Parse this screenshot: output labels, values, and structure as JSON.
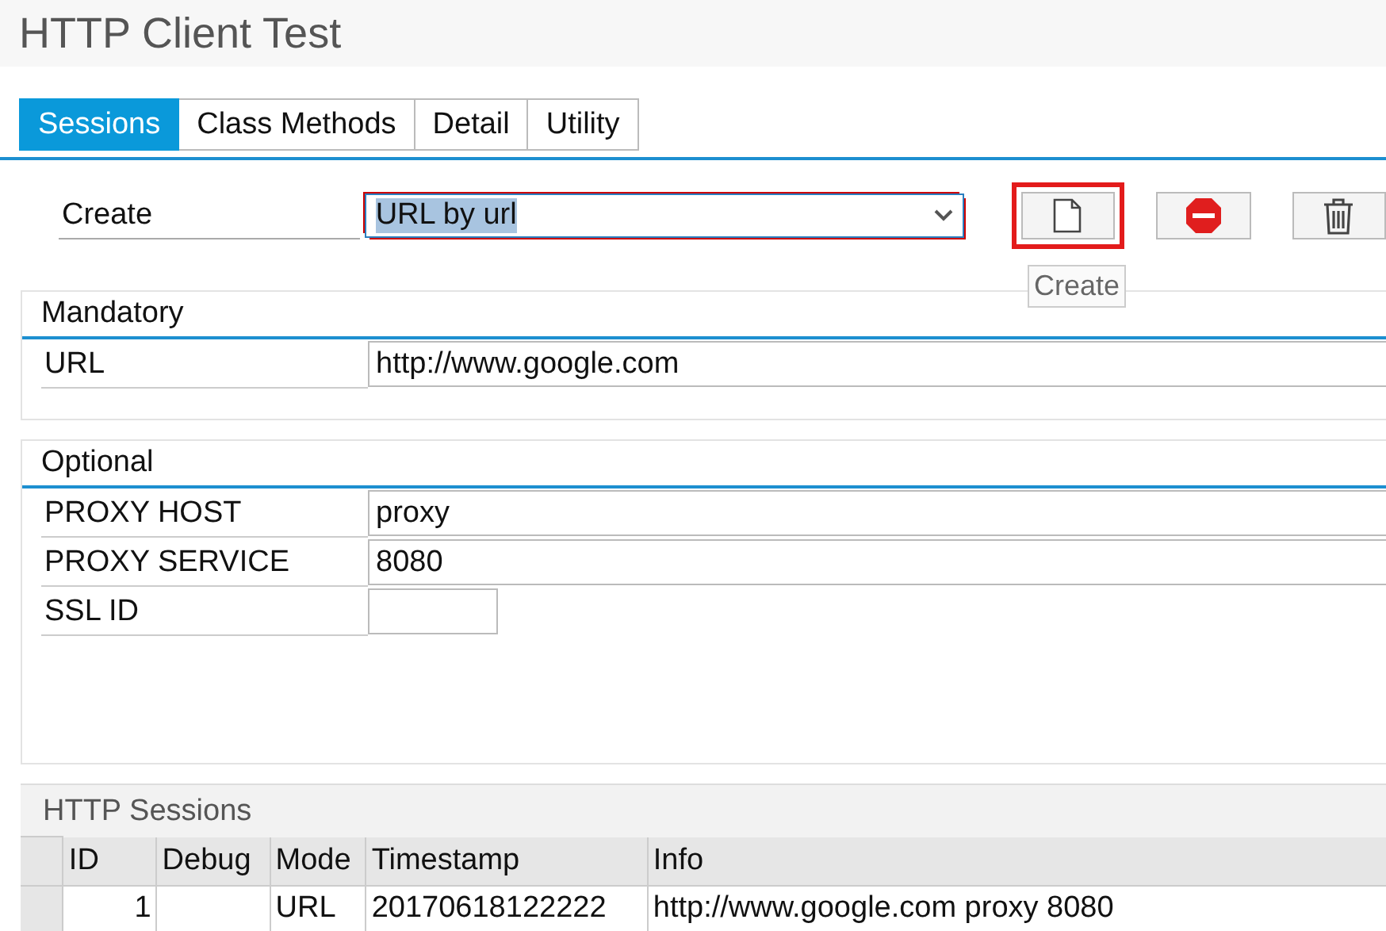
{
  "window": {
    "title": "HTTP Client Test"
  },
  "tabs": [
    {
      "label": "Sessions",
      "selected": true
    },
    {
      "label": "Class Methods",
      "selected": false
    },
    {
      "label": "Detail",
      "selected": false
    },
    {
      "label": "Utility",
      "selected": false
    }
  ],
  "create": {
    "label": "Create",
    "value": "URL by url",
    "tooltip": "Create"
  },
  "mandatory": {
    "title": "Mandatory",
    "fields": [
      {
        "label": "URL",
        "value": "http://www.google.com"
      }
    ]
  },
  "optional": {
    "title": "Optional",
    "fields": [
      {
        "label": "PROXY HOST",
        "value": "proxy"
      },
      {
        "label": "PROXY SERVICE",
        "value": "8080"
      },
      {
        "label": "SSL ID"
      }
    ]
  },
  "sessions": {
    "title": "HTTP Sessions",
    "columns": [
      "ID",
      "Debug",
      "Mode",
      "Timestamp",
      "Info"
    ],
    "rows": [
      [
        "1",
        "",
        "URL",
        "20170618122222",
        "http://www.google.com proxy 8080"
      ]
    ]
  }
}
